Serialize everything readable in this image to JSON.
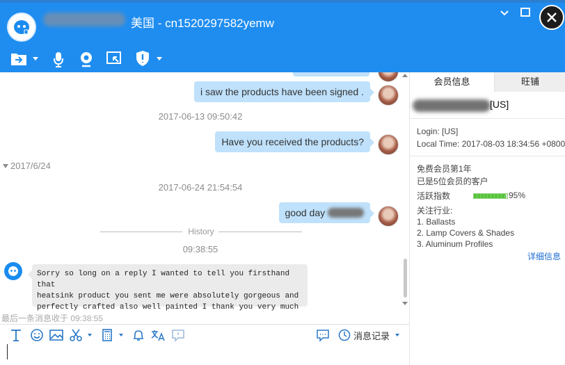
{
  "header": {
    "title": "美国 - cn1520297582yemw",
    "toolbar_icons": [
      "folder-send-icon",
      "microphone-icon",
      "video-call-icon",
      "screenshot-icon",
      "shield-icon"
    ]
  },
  "chat": {
    "messages_right": [
      {
        "text": "i saw the products have been signed ."
      },
      {
        "text": "Have you received the products?"
      },
      {
        "text": "good day"
      }
    ],
    "timestamps": [
      "2017-06-13 09:50:42",
      "2017-06-24 21:54:54"
    ],
    "date_group": "2017/6/24",
    "history_label": "History",
    "history_time": "09:38:55",
    "incoming_lines": [
      "Sorry so long on a reply I wanted to tell you firsthand that",
      "heatsink product you sent me were absolutely gorgeous and",
      "perfectly crafted also well painted I thank you very much"
    ],
    "last_message_note": "最后一条消息收于 09:38:55"
  },
  "input_toolbar": {
    "history_button": "消息记录"
  },
  "right_panel": {
    "tabs": [
      "会员信息",
      "旺铺"
    ],
    "member_suffix": "[US]",
    "login": "Login: [US]",
    "local_time": "Local Time: 2017-08-03 18:34:56 +0800",
    "member_level": "免费会员第1年",
    "customer_note": "已是5位会员的客户",
    "activity_label": "活跃指数",
    "activity_percent": "95%",
    "activity_value": 0.95,
    "industry_label": "关注行业:",
    "industries": [
      "1. Ballasts",
      "2. Lamp Covers & Shades",
      "3. Aluminum Profiles"
    ],
    "detail_link": "详细信息"
  },
  "colors": {
    "header_blue": "#1f8df0",
    "bubble_blue": "#bfe1fb",
    "bubble_gray": "#ebebeb",
    "activity_green": "#57c43c",
    "link_blue": "#1a6bd0"
  }
}
